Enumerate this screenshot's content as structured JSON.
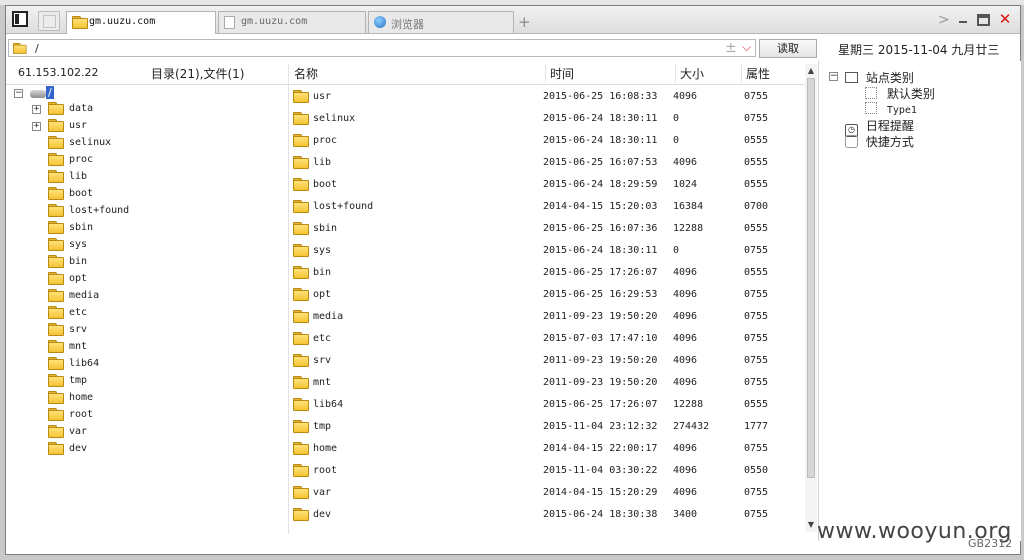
{
  "tabs": [
    {
      "label": "gm.uuzu.com",
      "active": true
    },
    {
      "label": "gm.uuzu.com",
      "active": false
    },
    {
      "label": "浏览器",
      "active": false
    }
  ],
  "path": {
    "value": "/",
    "read_button": "读取"
  },
  "date_line": "星期三 2015-11-04 九月廿三",
  "left": {
    "ip": "61.153.102.22",
    "counts": "目录(21),文件(1)",
    "root_label": "/",
    "items": [
      {
        "name": "data",
        "expander": "+"
      },
      {
        "name": "usr",
        "expander": "+"
      },
      {
        "name": "selinux"
      },
      {
        "name": "proc"
      },
      {
        "name": "lib"
      },
      {
        "name": "boot"
      },
      {
        "name": "lost+found"
      },
      {
        "name": "sbin"
      },
      {
        "name": "sys"
      },
      {
        "name": "bin"
      },
      {
        "name": "opt"
      },
      {
        "name": "media"
      },
      {
        "name": "etc"
      },
      {
        "name": "srv"
      },
      {
        "name": "mnt"
      },
      {
        "name": "lib64"
      },
      {
        "name": "tmp"
      },
      {
        "name": "home"
      },
      {
        "name": "root"
      },
      {
        "name": "var"
      },
      {
        "name": "dev"
      }
    ]
  },
  "columns": {
    "name": "名称",
    "time": "时间",
    "size": "大小",
    "attr": "属性"
  },
  "rows": [
    {
      "name": "usr",
      "time": "2015-06-25 16:08:33",
      "size": "4096",
      "attr": "0755"
    },
    {
      "name": "selinux",
      "time": "2015-06-24 18:30:11",
      "size": "0",
      "attr": "0755"
    },
    {
      "name": "proc",
      "time": "2015-06-24 18:30:11",
      "size": "0",
      "attr": "0555"
    },
    {
      "name": "lib",
      "time": "2015-06-25 16:07:53",
      "size": "4096",
      "attr": "0555"
    },
    {
      "name": "boot",
      "time": "2015-06-24 18:29:59",
      "size": "1024",
      "attr": "0555"
    },
    {
      "name": "lost+found",
      "time": "2014-04-15 15:20:03",
      "size": "16384",
      "attr": "0700"
    },
    {
      "name": "sbin",
      "time": "2015-06-25 16:07:36",
      "size": "12288",
      "attr": "0555"
    },
    {
      "name": "sys",
      "time": "2015-06-24 18:30:11",
      "size": "0",
      "attr": "0755"
    },
    {
      "name": "bin",
      "time": "2015-06-25 17:26:07",
      "size": "4096",
      "attr": "0555"
    },
    {
      "name": "opt",
      "time": "2015-06-25 16:29:53",
      "size": "4096",
      "attr": "0755"
    },
    {
      "name": "media",
      "time": "2011-09-23 19:50:20",
      "size": "4096",
      "attr": "0755"
    },
    {
      "name": "etc",
      "time": "2015-07-03 17:47:10",
      "size": "4096",
      "attr": "0755"
    },
    {
      "name": "srv",
      "time": "2011-09-23 19:50:20",
      "size": "4096",
      "attr": "0755"
    },
    {
      "name": "mnt",
      "time": "2011-09-23 19:50:20",
      "size": "4096",
      "attr": "0755"
    },
    {
      "name": "lib64",
      "time": "2015-06-25 17:26:07",
      "size": "12288",
      "attr": "0555"
    },
    {
      "name": "tmp",
      "time": "2015-11-04 23:12:32",
      "size": "274432",
      "attr": "1777"
    },
    {
      "name": "home",
      "time": "2014-04-15 22:00:17",
      "size": "4096",
      "attr": "0755"
    },
    {
      "name": "root",
      "time": "2015-11-04 03:30:22",
      "size": "4096",
      "attr": "0550"
    },
    {
      "name": "var",
      "time": "2014-04-15 15:20:29",
      "size": "4096",
      "attr": "0755"
    },
    {
      "name": "dev",
      "time": "2015-06-24 18:30:38",
      "size": "3400",
      "attr": "0755"
    }
  ],
  "right": {
    "site_category": "站点类别",
    "default_category": "默认类别",
    "type1": "Type1",
    "schedule": "日程提醒",
    "shortcuts": "快捷方式"
  },
  "watermark": "www.wooyun.org",
  "code": "GB2312"
}
